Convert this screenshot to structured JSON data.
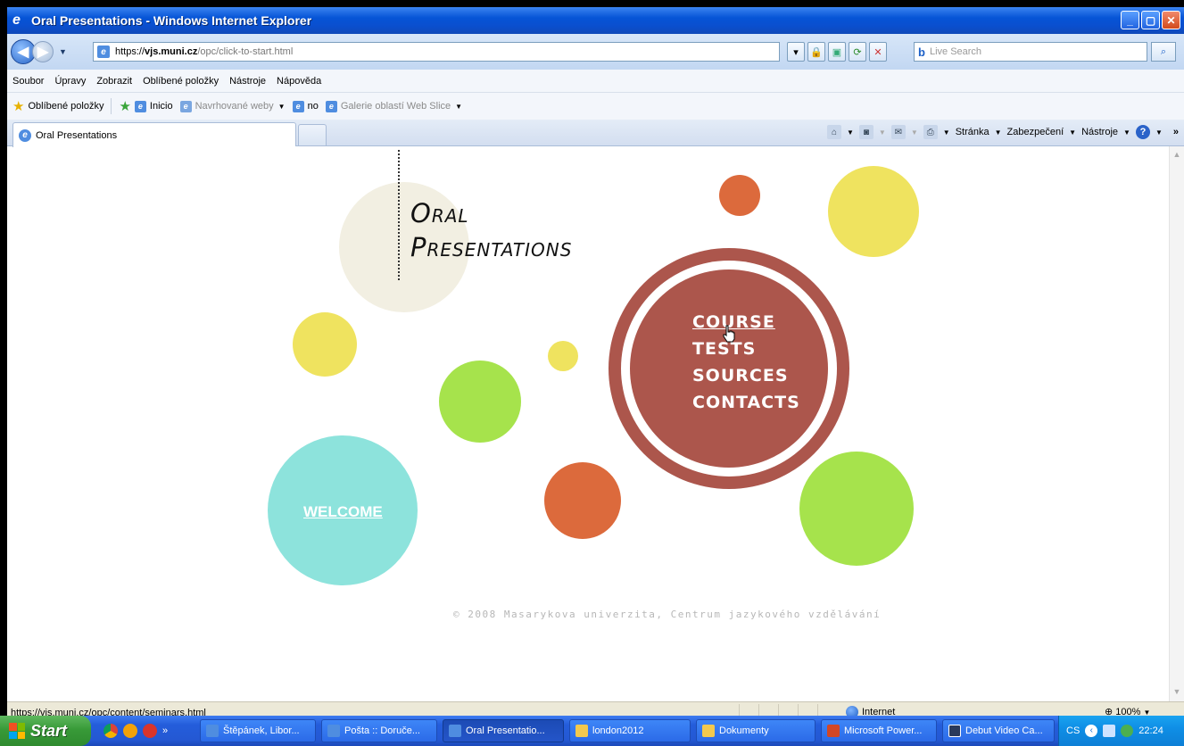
{
  "window": {
    "title": "Oral Presentations - Windows Internet Explorer",
    "buttons": [
      "_",
      "▢",
      "✕"
    ]
  },
  "address": {
    "protocol": "https://",
    "domain": "vjs.muni.cz",
    "path": "/opc/click-to-start.html",
    "search_placeholder": "Live Search"
  },
  "menubar": {
    "items": [
      "Soubor",
      "Úpravy",
      "Zobrazit",
      "Oblíbené položky",
      "Nástroje",
      "Nápověda"
    ]
  },
  "favorites": {
    "label": "Oblíbené položky",
    "items": [
      {
        "label": "Inicio",
        "muted": false
      },
      {
        "label": "Navrhované weby",
        "muted": true
      },
      {
        "label": "no",
        "muted": false
      },
      {
        "label": "Galerie oblastí Web Slice",
        "muted": true
      }
    ]
  },
  "tab": {
    "label": "Oral Presentations"
  },
  "command_bar": {
    "page": "Stránka",
    "safety": "Zabezpečení",
    "tools": "Nástroje",
    "more": "»"
  },
  "page": {
    "title_line1": "Oral",
    "title_line2": "Presentations",
    "nav": [
      "COURSE",
      "TESTS",
      "SOURCES",
      "CONTACTS"
    ],
    "welcome": "WELCOME",
    "copyright": "© 2008 Masarykova univerzita, Centrum jazykového vzdělávání",
    "colors": {
      "yellow": "#efe35f",
      "orange": "#dc6a3c",
      "green": "#a6e34c",
      "teal": "#8de3dc",
      "red": "#ac564c",
      "beige": "#f2efe2"
    }
  },
  "status": {
    "url": "https://vjs.muni.cz/opc/content/seminars.html",
    "zone": "Internet",
    "zoom": "100%"
  },
  "taskbar": {
    "start": "Start",
    "more": "»",
    "buttons": [
      {
        "label": "Štěpánek, Libor..."
      },
      {
        "label": "Pošta :: Doruče..."
      },
      {
        "label": "Oral Presentatio...",
        "active": true
      },
      {
        "label": "london2012"
      },
      {
        "label": "Dokumenty"
      },
      {
        "label": "Microsoft Power..."
      },
      {
        "label": "Debut Video Ca..."
      }
    ],
    "lang": "CS",
    "clock": "22:24"
  }
}
